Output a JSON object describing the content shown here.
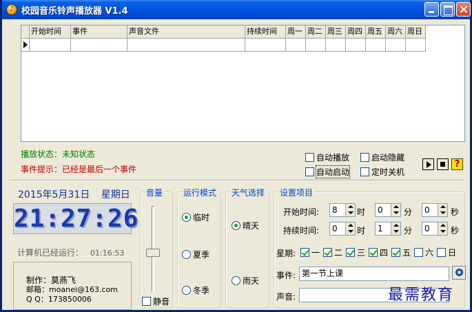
{
  "window": {
    "title": "校园音乐铃声播放器 V1.4"
  },
  "schedule_table": {
    "columns": [
      "开始时间",
      "事件",
      "声音文件",
      "持续时间",
      "周一",
      "周二",
      "周三",
      "周四",
      "周五",
      "周六",
      "周日"
    ],
    "rows": []
  },
  "status": {
    "play_state": "播放状态：未知状态",
    "event_hint": "事件提示：已经是最后一个事件"
  },
  "options": {
    "auto_play": {
      "label": "自动播放",
      "checked": false
    },
    "start_hidden": {
      "label": "启动隐藏",
      "checked": false
    },
    "auto_start": {
      "label": "自动启动",
      "checked": false
    },
    "timed_shutdown": {
      "label": "定时关机",
      "checked": false
    }
  },
  "controls": {
    "help_label": "?"
  },
  "clock": {
    "date": "2015年5月31日",
    "weekday": "星期日",
    "time": "21:27:26",
    "uptime_label": "计算机已经运行：",
    "uptime_value": "01:16:53"
  },
  "author": {
    "maker": "制作：莫燕飞",
    "email_label": "邮箱：",
    "email": "moanei@163.com",
    "qq_label": "Q Q：",
    "qq": "173850006"
  },
  "volume": {
    "title": "音量",
    "level": 0.45,
    "mute_label": "静音",
    "mute_checked": false
  },
  "run_mode": {
    "title": "运行模式",
    "options": [
      {
        "label": "临时",
        "selected": true
      },
      {
        "label": "夏季",
        "selected": false
      },
      {
        "label": "冬季",
        "selected": false
      }
    ]
  },
  "weather": {
    "title": "天气选择",
    "options": [
      {
        "label": "晴天",
        "selected": true
      },
      {
        "label": "雨天",
        "selected": false
      }
    ]
  },
  "settings": {
    "title": "设置项目",
    "start_time_label": "开始时间:",
    "duration_label": "持续时间:",
    "start": {
      "hour": "8",
      "minute": "0",
      "second": "0"
    },
    "duration": {
      "hour": "0",
      "minute": "1",
      "second": "0"
    },
    "unit_hour": "时",
    "unit_minute": "分",
    "unit_second": "秒",
    "weekday_label": "星期:",
    "weekdays": [
      {
        "label": "一",
        "checked": true
      },
      {
        "label": "二",
        "checked": true
      },
      {
        "label": "三",
        "checked": true
      },
      {
        "label": "四",
        "checked": true
      },
      {
        "label": "五",
        "checked": true
      },
      {
        "label": "六",
        "checked": false
      },
      {
        "label": "日",
        "checked": false
      }
    ],
    "event_label": "事件:",
    "event_value": "第一节上课",
    "sound_label": "声音:",
    "sound_value": ""
  },
  "watermark": "最需教育"
}
